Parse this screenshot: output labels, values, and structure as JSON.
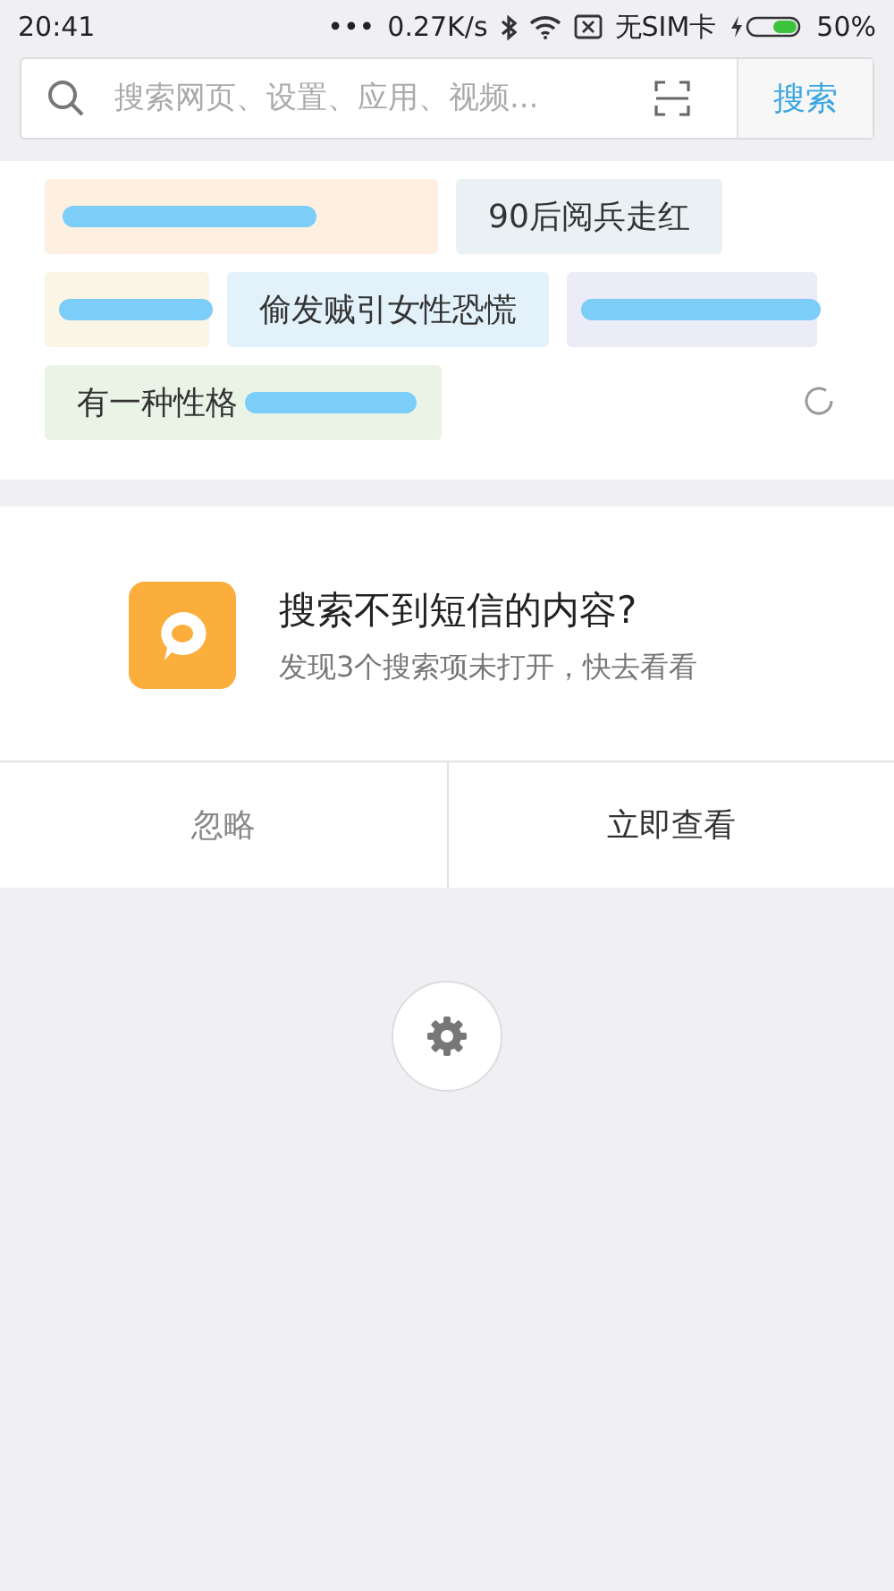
{
  "status_bar": {
    "time": "20:41",
    "dots": "•••",
    "speed": "0.27K/s",
    "sim": "无SIM卡",
    "battery": "50%",
    "battery_icon": {
      "level": 0.5
    }
  },
  "search": {
    "placeholder": "搜索网页、设置、应用、视频...",
    "button": "搜索"
  },
  "hot_tags": [
    {
      "color": "#fdf0e1",
      "scribbled": true
    },
    {
      "label": "90后阅兵走红",
      "color": "#e9f1f4",
      "scribbled": false
    },
    {
      "color": "#faf5e4",
      "scribbled": true
    },
    {
      "label": "偷发贼引女性恐慌",
      "color": "#e3f1fb",
      "scribbled": false
    },
    {
      "color": "#ecebf8",
      "scribbled": true
    },
    {
      "label": "有一种性格",
      "color": "#e9f4e6",
      "scribbled": true
    }
  ],
  "prompt_card": {
    "title": "搜索不到短信的内容?",
    "subtitle": "发现3个搜索项未打开，快去看看",
    "buttons": [
      {
        "label": "忽略",
        "kind": "secondary"
      },
      {
        "label": "立即查看",
        "kind": "primary"
      }
    ]
  }
}
